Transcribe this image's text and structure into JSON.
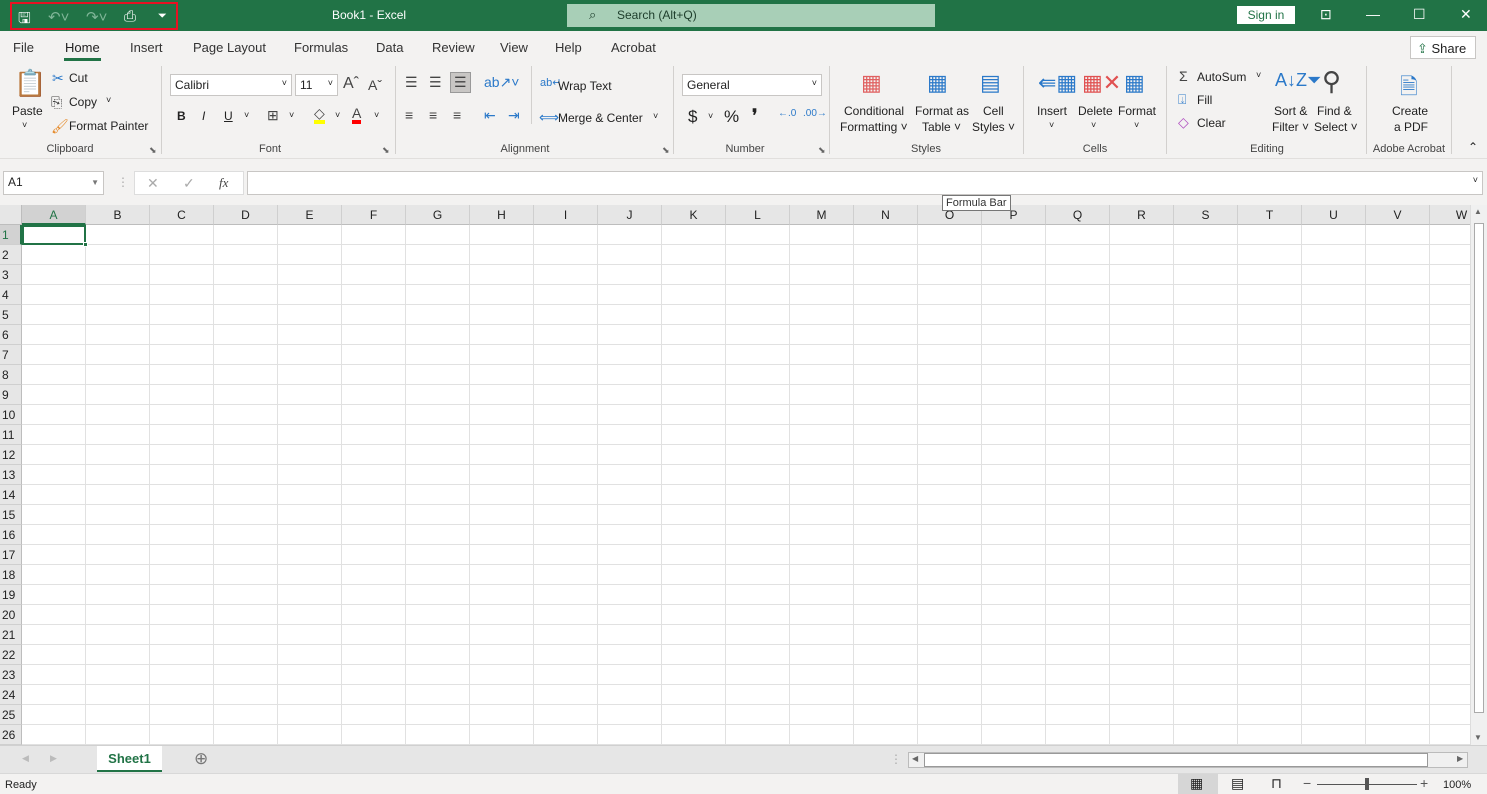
{
  "colors": {
    "brand": "#217346",
    "highlight": "#ffff00",
    "font_color": "#ff0000",
    "qat_outline": "#e81123"
  },
  "qat": {
    "icons": [
      "save-icon",
      "undo-icon",
      "redo-icon",
      "print-preview-icon",
      "customize-qat-icon"
    ]
  },
  "title": "Book1  -  Excel",
  "search": {
    "placeholder": "Search (Alt+Q)"
  },
  "account": {
    "sign_in": "Sign in"
  },
  "tabs": [
    "File",
    "Home",
    "Insert",
    "Page Layout",
    "Formulas",
    "Data",
    "Review",
    "View",
    "Help",
    "Acrobat"
  ],
  "active_tab": "Home",
  "share": "Share",
  "ribbon": {
    "clipboard": {
      "label": "Clipboard",
      "paste": "Paste",
      "cut": "Cut",
      "copy": "Copy",
      "format_painter": "Format Painter"
    },
    "font": {
      "label": "Font",
      "font_name": "Calibri",
      "font_size": "11",
      "bold": "B",
      "italic": "I",
      "underline": "U"
    },
    "alignment": {
      "label": "Alignment",
      "wrap_text": "Wrap Text",
      "merge_center": "Merge & Center"
    },
    "number": {
      "label": "Number",
      "format": "General",
      "currency": "$",
      "percent": "%",
      "comma": "❜"
    },
    "styles": {
      "label": "Styles",
      "conditional": [
        "Conditional",
        "Formatting ˅"
      ],
      "format_table": [
        "Format as",
        "Table ˅"
      ],
      "cell_styles": [
        "Cell",
        "Styles ˅"
      ]
    },
    "cells": {
      "label": "Cells",
      "insert": "Insert",
      "delete": "Delete",
      "format": "Format"
    },
    "editing": {
      "label": "Editing",
      "autosum": "AutoSum",
      "fill": "Fill",
      "clear": "Clear",
      "sort": [
        "Sort &",
        "Filter ˅"
      ],
      "find": [
        "Find &",
        "Select ˅"
      ]
    },
    "acrobat": {
      "label": "Adobe Acrobat",
      "create": [
        "Create",
        "a PDF"
      ]
    }
  },
  "formula_bar": {
    "name_box": "A1",
    "fx": "fx",
    "value": "",
    "tooltip": "Formula Bar"
  },
  "sheet": {
    "columns": [
      "A",
      "B",
      "C",
      "D",
      "E",
      "F",
      "G",
      "H",
      "I",
      "J",
      "K",
      "L",
      "M",
      "N",
      "O",
      "P",
      "Q",
      "R",
      "S",
      "T",
      "U",
      "V",
      "W"
    ],
    "rows": [
      "1",
      "2",
      "3",
      "4",
      "5",
      "6",
      "7",
      "8",
      "9",
      "10",
      "11",
      "12",
      "13",
      "14",
      "15",
      "16",
      "17",
      "18",
      "19",
      "20",
      "21",
      "22",
      "23",
      "24",
      "25",
      "26"
    ],
    "selected_cell": "A1"
  },
  "sheet_tabs": [
    "Sheet1"
  ],
  "status": {
    "text": "Ready",
    "zoom": "100%",
    "zoom_percent": 100
  }
}
